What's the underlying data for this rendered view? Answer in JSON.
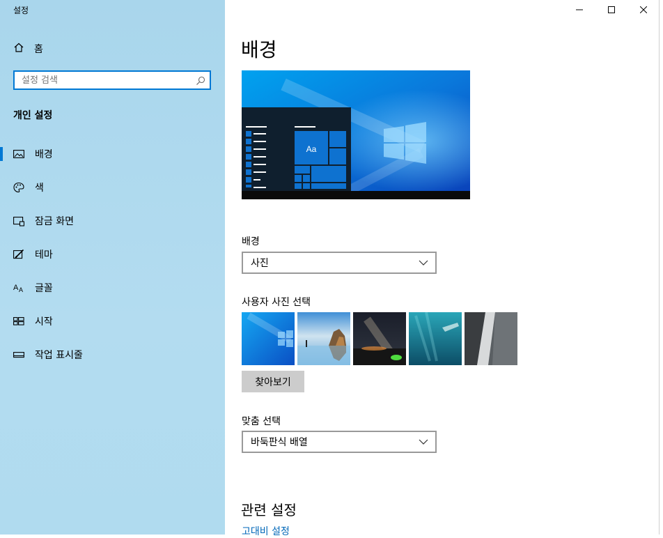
{
  "window": {
    "title": "설정"
  },
  "sidebar": {
    "home_label": "홈",
    "search_placeholder": "설정 검색",
    "section_title": "개인 설정",
    "items": [
      {
        "label": "배경",
        "icon": "picture-icon",
        "active": true
      },
      {
        "label": "색",
        "icon": "palette-icon",
        "active": false
      },
      {
        "label": "잠금 화면",
        "icon": "lock-screen-icon",
        "active": false
      },
      {
        "label": "테마",
        "icon": "theme-icon",
        "active": false
      },
      {
        "label": "글꼴",
        "icon": "font-icon",
        "active": false
      },
      {
        "label": "시작",
        "icon": "start-icon",
        "active": false
      },
      {
        "label": "작업 표시줄",
        "icon": "taskbar-icon",
        "active": false
      }
    ]
  },
  "main": {
    "title": "배경",
    "preview": {
      "tile_text": "Aa"
    },
    "background_label": "배경",
    "background_value": "사진",
    "choose_picture_label": "사용자 사진 선택",
    "browse_label": "찾아보기",
    "fit_label": "맞춤 선택",
    "fit_value": "바둑판식 배열",
    "related_title": "관련 설정",
    "related_link": "고대비 설정"
  },
  "colors": {
    "accent": "#0078d4",
    "sidebar_bg": "#b0dbef",
    "link": "#0067b8"
  }
}
